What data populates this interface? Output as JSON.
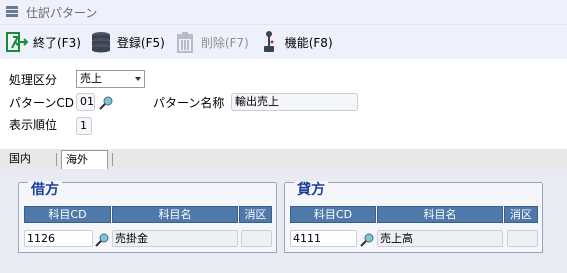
{
  "window": {
    "title": "仕訳パターン"
  },
  "toolbar": {
    "buttons": [
      {
        "label": "終了(F3)",
        "icon": "exit-icon",
        "enabled": true
      },
      {
        "label": "登録(F5)",
        "icon": "database-icon",
        "enabled": true
      },
      {
        "label": "削除(F7)",
        "icon": "trash-icon",
        "enabled": false
      },
      {
        "label": "機能(F8)",
        "icon": "joystick-icon",
        "enabled": true
      }
    ]
  },
  "form": {
    "category_label": "処理区分",
    "category_value": "売上",
    "pattern_cd_label": "パターンCD",
    "pattern_cd_value": "01",
    "pattern_name_label": "パターン名称",
    "pattern_name_value": "輸出売上",
    "display_order_label": "表示順位",
    "display_order_value": "1"
  },
  "tabs": [
    {
      "label": "国内",
      "selected": false
    },
    {
      "label": "海外",
      "selected": true
    }
  ],
  "debit": {
    "title": "借方",
    "headers": {
      "code": "科目CD",
      "name": "科目名",
      "tax": "消区"
    },
    "row": {
      "code": "1126",
      "name": "売掛金",
      "tax": ""
    }
  },
  "credit": {
    "title": "貸方",
    "headers": {
      "code": "科目CD",
      "name": "科目名",
      "tax": "消区"
    },
    "row": {
      "code": "4111",
      "name": "売上高",
      "tax": ""
    }
  },
  "colors": {
    "header_bg": "#4f79aa",
    "group_title": "#1e3f9a",
    "toolbar_bg": "#eef1fb"
  }
}
